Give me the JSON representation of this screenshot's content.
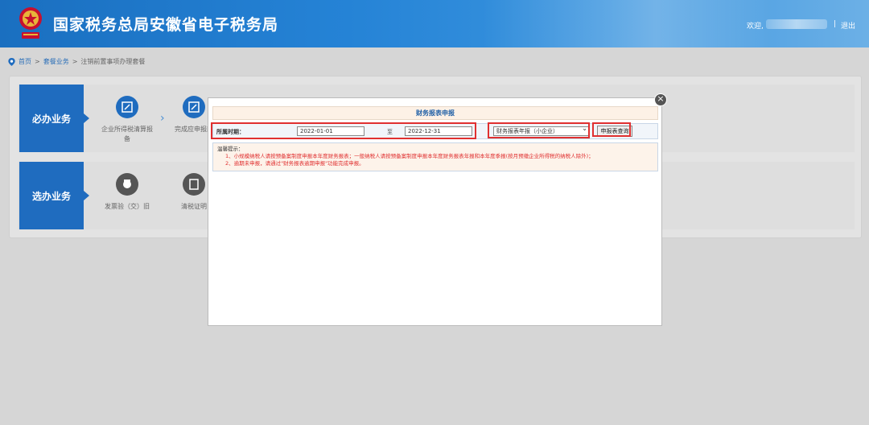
{
  "header": {
    "site_title": "国家税务总局安徽省电子税务局",
    "welcome": "欢迎,",
    "separator": "|",
    "logout": "退出"
  },
  "breadcrumb": {
    "home": "首页",
    "arrow1": ">",
    "section": "套餐业务",
    "arrow2": ">",
    "current": "注销前置事项办理套餐"
  },
  "sections": {
    "required": {
      "label": "必办业务",
      "tiles": [
        {
          "label": "企业所得税清算报备",
          "icon": "edit-icon"
        },
        {
          "label": "完成应申报款",
          "icon": "edit-icon"
        }
      ]
    },
    "optional": {
      "label": "选办业务",
      "tiles": [
        {
          "label": "发票验（交）旧",
          "icon": "invoice-badge-icon"
        },
        {
          "label": "清税证明",
          "icon": "document-icon"
        }
      ]
    }
  },
  "modal": {
    "title": "财务报表申报",
    "period_label": "所属时期：",
    "date_from": "2022-01-01",
    "to_label": "至",
    "date_to": "2022-12-31",
    "report_type": "财务报表年报（小企业）",
    "query_button": "申报表查询",
    "tips_head": "温馨提示：",
    "tips": [
      "1、小规模纳税人请按预备案制度申报本年度财务报表；一般纳税人请按预备案制度申报本年度财务报表年报和本年度季报(按月预缴企业所得税的纳税人除外)；",
      "2、逾期未申报，请通过\"财务报表逾期申报\"功能完成申报。"
    ],
    "close_symbol": "×"
  },
  "colors": {
    "header_blue": "#1f6cbf",
    "highlight_red": "#e03030",
    "modal_title_blue": "#1f5fa6"
  }
}
